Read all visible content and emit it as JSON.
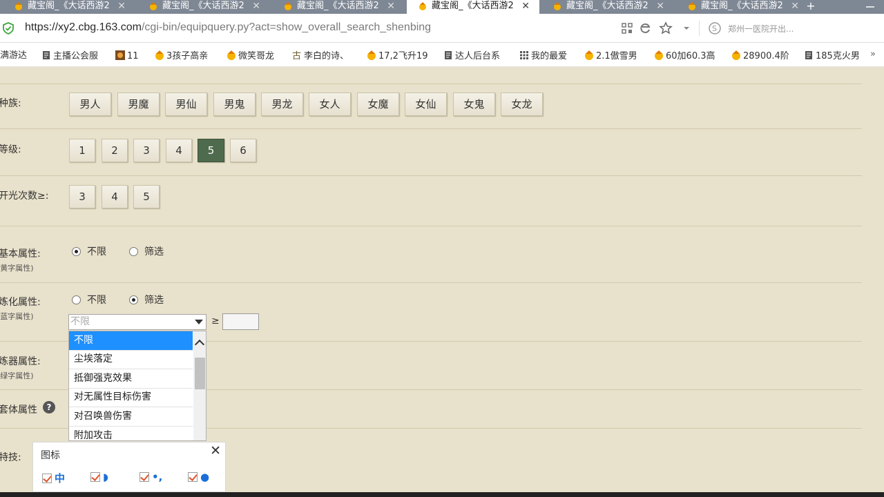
{
  "browser": {
    "tabs": [
      {
        "title": "藏宝阁_《大话西游2",
        "active": false
      },
      {
        "title": "藏宝阁_《大话西游2",
        "active": false
      },
      {
        "title": "藏宝阁_《大话西游2",
        "active": false
      },
      {
        "title": "藏宝阁_《大话西游2",
        "active": true
      },
      {
        "title": "藏宝阁_《大话西游2",
        "active": false
      },
      {
        "title": "藏宝阁_《大话西游2",
        "active": false
      }
    ],
    "url_host": "https://xy2.cbg.163.com",
    "url_path": "/cgi-bin/equipquery.py?act=show_overall_search_shenbing",
    "news_text": "郑州一医院开出...",
    "bookmarks": [
      {
        "label": "满游达",
        "icon": "none"
      },
      {
        "label": "主播公会服",
        "icon": "page-icon"
      },
      {
        "label": "11",
        "icon": "game-icon"
      },
      {
        "label": "3孩子高亲",
        "icon": "treasure-icon"
      },
      {
        "label": "微笑哥龙",
        "icon": "treasure-icon"
      },
      {
        "label": "李白的诗、",
        "icon": "ancient-icon"
      },
      {
        "label": "17,2飞升19",
        "icon": "treasure-icon"
      },
      {
        "label": "达人后台系",
        "icon": "page-icon"
      },
      {
        "label": "我的最爱",
        "icon": "grid-icon"
      },
      {
        "label": "2.1傲雪男",
        "icon": "treasure-icon"
      },
      {
        "label": "60加60.3高",
        "icon": "treasure-icon"
      },
      {
        "label": "28900.4阶",
        "icon": "treasure-icon"
      },
      {
        "label": "185克火男",
        "icon": "page-icon"
      }
    ],
    "bookmarks_more": "»"
  },
  "filters": {
    "race_label": "种族:",
    "races": [
      "男人",
      "男魔",
      "男仙",
      "男鬼",
      "男龙",
      "女人",
      "女魔",
      "女仙",
      "女鬼",
      "女龙"
    ],
    "level_label": "等级:",
    "levels": [
      "1",
      "2",
      "3",
      "4",
      "5",
      "6"
    ],
    "level_selected": "5",
    "kaiguang_label": "开光次数≥:",
    "kaiguang": [
      "3",
      "4",
      "5"
    ],
    "basic_attr": {
      "label": "基本属性:",
      "sub": "(黄字属性)",
      "options": [
        "不限",
        "筛选"
      ],
      "selected": "不限"
    },
    "refine_attr": {
      "label": "炼化属性:",
      "sub": "(蓝字属性)",
      "options": [
        "不限",
        "筛选"
      ],
      "selected": "筛选"
    },
    "refine_select": {
      "value": "不限",
      "gte": "≥"
    },
    "refine_options": [
      "不限",
      "尘埃落定",
      "抵御强克效果",
      "对无属性目标伤害",
      "对召唤兽伤害",
      "附加攻击"
    ],
    "refine_highlighted": "不限",
    "lianqi_attr": {
      "label": "炼器属性:",
      "sub": "(绿字属性)"
    },
    "set_attr": {
      "label": "套体属性",
      "help": "?"
    },
    "skill_label": "特技:"
  },
  "icon_panel": {
    "title": "图标",
    "close": "✕",
    "items": [
      {
        "icon": "text-zhong-icon",
        "glyph": "中",
        "checked": true
      },
      {
        "icon": "moon-icon",
        "glyph": "◗",
        "checked": true
      },
      {
        "icon": "dots-icon",
        "glyph": "•,",
        "checked": true
      },
      {
        "icon": "user-icon",
        "glyph": "●",
        "checked": true
      }
    ]
  },
  "colors": {
    "page_bg": "#e8e1cb",
    "selected_button": "#4f6b4d",
    "highlight": "#1e90ff",
    "url_host": "#2b2b2b"
  }
}
